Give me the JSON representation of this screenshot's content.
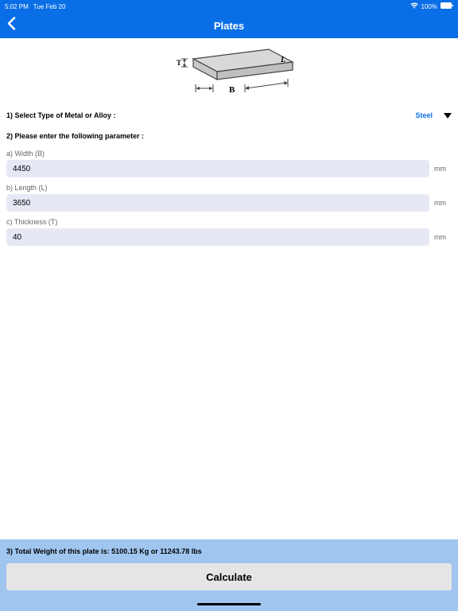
{
  "status": {
    "time": "5:02 PM",
    "date": "Tue Feb 20",
    "battery": "100%"
  },
  "header": {
    "title": "Plates"
  },
  "labels": {
    "selectType": "1) Select Type of Metal or Alloy :",
    "enterParams": "2) Please enter the following parameter :",
    "widthLabel": "a) Width (B)",
    "lengthLabel": "b) Length (L)",
    "thicknessLabel": "c) Thickness (T)"
  },
  "material": {
    "value": "Steel"
  },
  "fields": {
    "width": {
      "value": "4450",
      "unit": "mm"
    },
    "length": {
      "value": "3650",
      "unit": "mm"
    },
    "thickness": {
      "value": "40",
      "unit": "mm"
    }
  },
  "result": {
    "prefix": "3) Total Weight of this plate is: ",
    "value": "5100.15 Kg or 11243.78 lbs"
  },
  "buttons": {
    "calculate": "Calculate"
  }
}
